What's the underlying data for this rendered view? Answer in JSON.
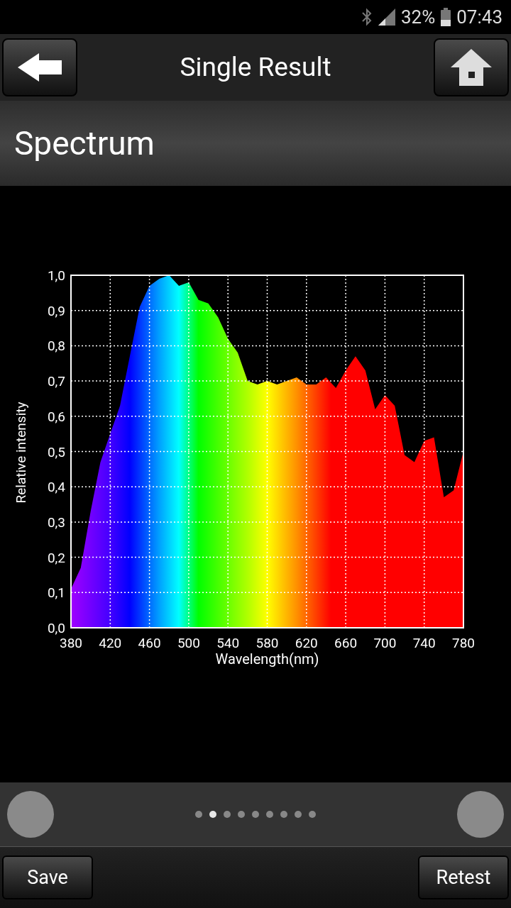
{
  "status_bar": {
    "battery": "32%",
    "time": "07:43"
  },
  "header": {
    "title": "Single Result"
  },
  "section": {
    "title": "Spectrum"
  },
  "chart_data": {
    "type": "area",
    "xlabel": "Wavelength(nm)",
    "ylabel": "Relative intensity",
    "x": [
      380,
      390,
      400,
      410,
      420,
      430,
      440,
      450,
      460,
      470,
      480,
      490,
      500,
      510,
      520,
      530,
      540,
      550,
      560,
      570,
      580,
      590,
      600,
      610,
      620,
      630,
      640,
      650,
      660,
      670,
      680,
      690,
      700,
      710,
      720,
      730,
      740,
      750,
      760,
      770,
      780
    ],
    "series": [
      {
        "values": [
          0.11,
          0.17,
          0.33,
          0.47,
          0.55,
          0.63,
          0.77,
          0.91,
          0.97,
          0.99,
          1.0,
          0.97,
          0.98,
          0.93,
          0.92,
          0.88,
          0.82,
          0.78,
          0.7,
          0.69,
          0.7,
          0.69,
          0.7,
          0.71,
          0.69,
          0.69,
          0.71,
          0.68,
          0.73,
          0.77,
          0.73,
          0.62,
          0.66,
          0.63,
          0.49,
          0.47,
          0.53,
          0.54,
          0.37,
          0.39,
          0.5
        ]
      }
    ],
    "grid": true,
    "xlim": [
      380,
      780
    ],
    "ylim": [
      0,
      1
    ],
    "xticks": [
      380,
      420,
      460,
      500,
      540,
      580,
      620,
      660,
      700,
      740,
      780
    ],
    "yticks": [
      {
        "value": 0,
        "label": "0,0"
      },
      {
        "value": 0.1,
        "label": "0,1"
      },
      {
        "value": 0.2,
        "label": "0,2"
      },
      {
        "value": 0.3,
        "label": "0,3"
      },
      {
        "value": 0.4,
        "label": "0,4"
      },
      {
        "value": 0.5,
        "label": "0,5"
      },
      {
        "value": 0.6,
        "label": "0,6"
      },
      {
        "value": 0.7,
        "label": "0,7"
      },
      {
        "value": 0.8,
        "label": "0,8"
      },
      {
        "value": 0.9,
        "label": "0,9"
      },
      {
        "value": 1,
        "label": "1,0"
      }
    ]
  },
  "pager": {
    "dots": [
      {
        "selected": false
      },
      {
        "selected": true
      },
      {
        "selected": false
      },
      {
        "selected": false
      },
      {
        "selected": false
      },
      {
        "selected": false
      },
      {
        "selected": false
      },
      {
        "selected": false
      },
      {
        "selected": false
      }
    ]
  },
  "buttons": [
    "Save",
    "Retest"
  ]
}
